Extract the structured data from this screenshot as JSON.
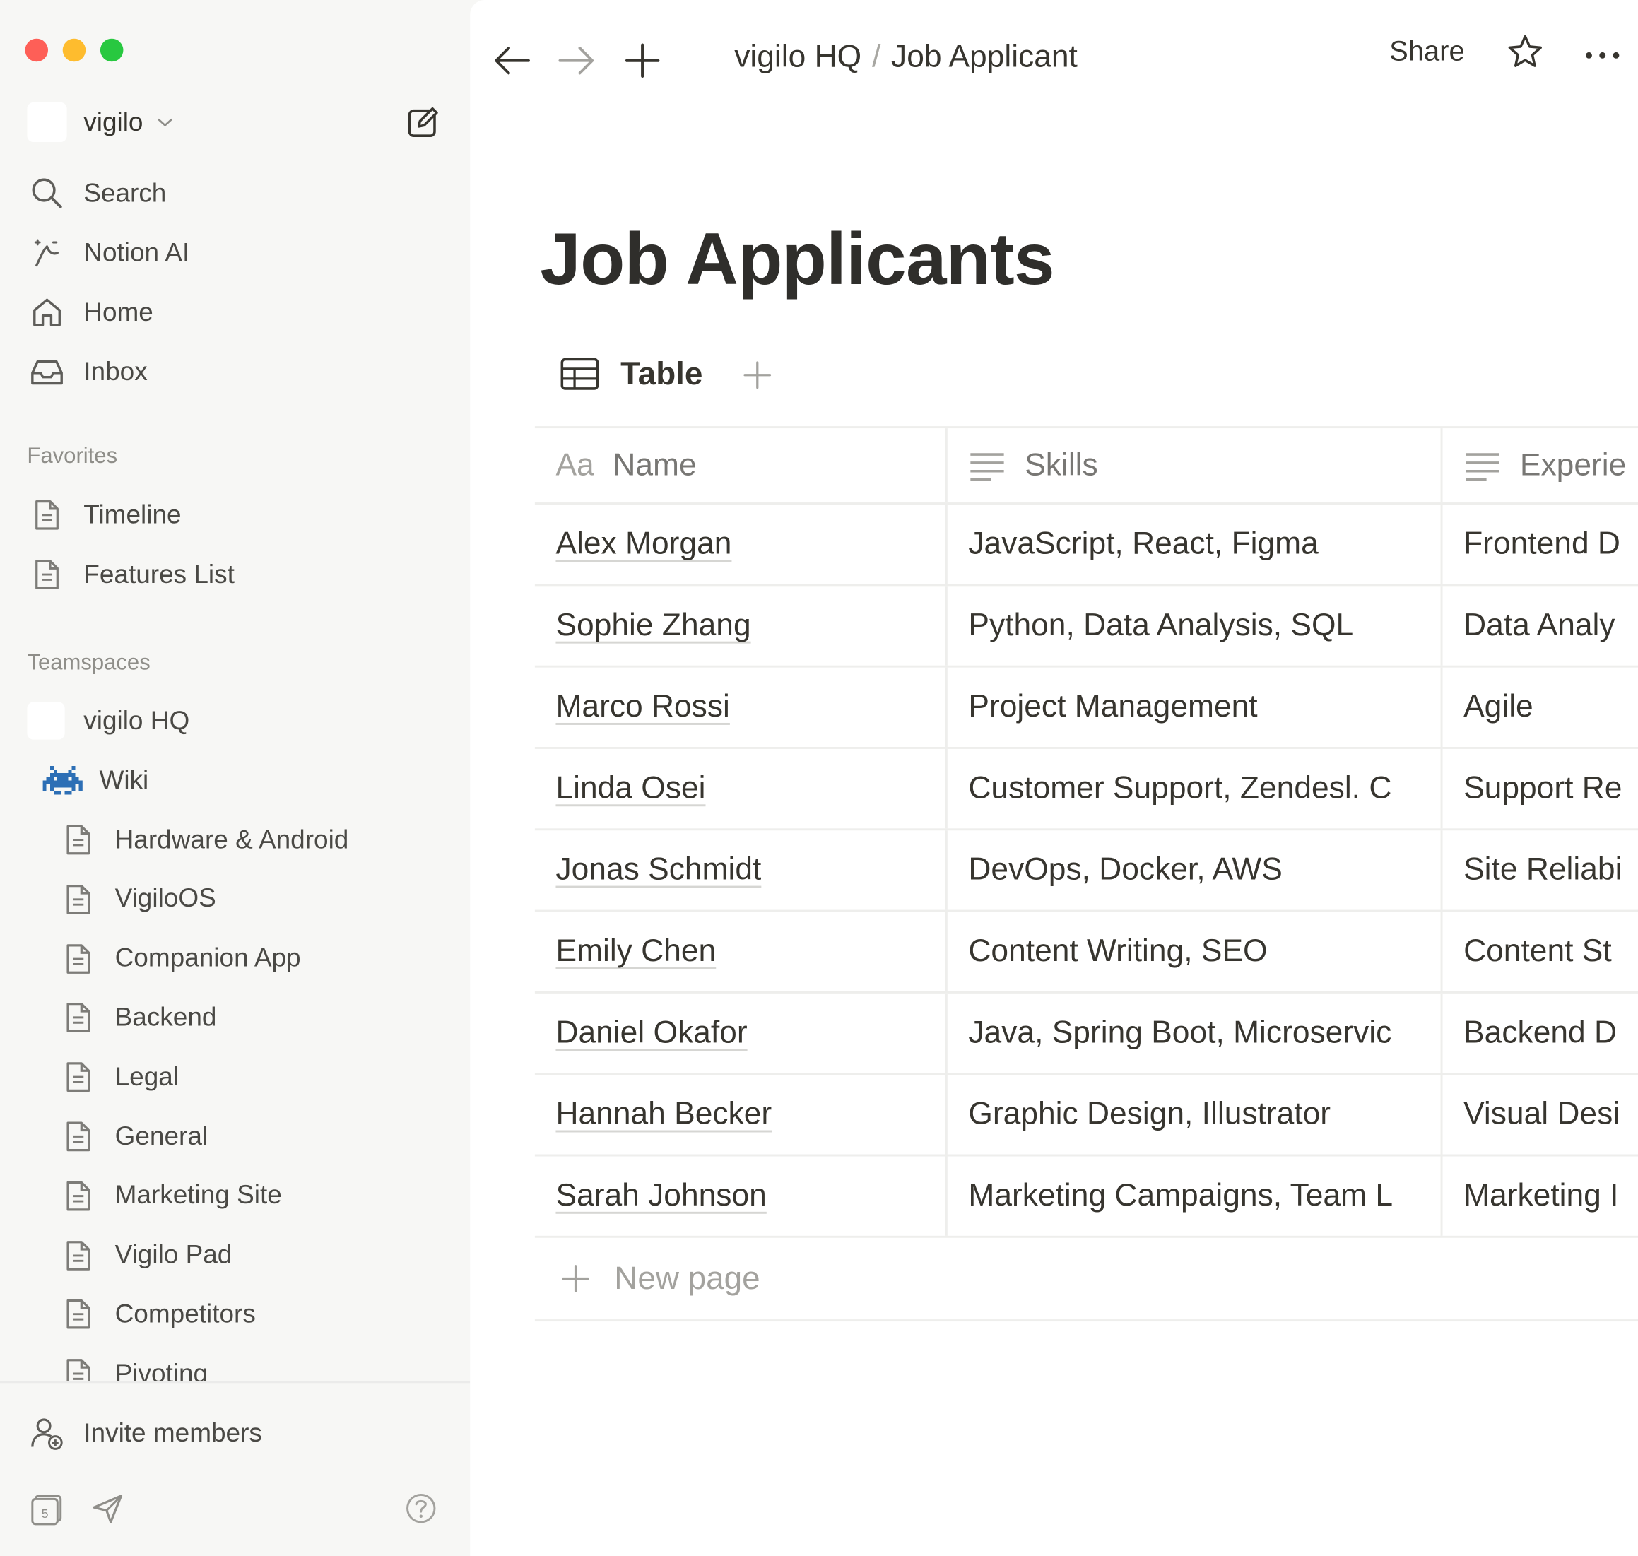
{
  "sidebar": {
    "workspace_name": "vigilo",
    "nav": [
      {
        "label": "Search",
        "icon": "search-icon"
      },
      {
        "label": "Notion AI",
        "icon": "notion-ai-icon"
      },
      {
        "label": "Home",
        "icon": "home-icon"
      },
      {
        "label": "Inbox",
        "icon": "inbox-icon"
      }
    ],
    "favorites_title": "Favorites",
    "favorites": [
      {
        "label": "Timeline",
        "icon": "page-icon"
      },
      {
        "label": "Features List",
        "icon": "page-icon"
      }
    ],
    "teamspaces_title": "Teamspaces",
    "teamspace": {
      "label": "vigilo HQ"
    },
    "wiki": {
      "label": "Wiki",
      "icon": "space-invader-icon"
    },
    "wiki_pages": [
      {
        "label": "Hardware & Android"
      },
      {
        "label": "VigiloOS"
      },
      {
        "label": "Companion App"
      },
      {
        "label": "Backend"
      },
      {
        "label": "Legal"
      },
      {
        "label": "General"
      },
      {
        "label": "Marketing Site"
      },
      {
        "label": "Vigilo Pad"
      },
      {
        "label": "Competitors"
      },
      {
        "label": "Pivoting"
      }
    ],
    "invite_label": "Invite members",
    "calendar_day": "5"
  },
  "topbar": {
    "breadcrumb_parent": "vigilo HQ",
    "breadcrumb_separator": "/",
    "breadcrumb_current": "Job Applicant",
    "share_label": "Share"
  },
  "page": {
    "title": "Job Applicants",
    "view_tab_label": "Table",
    "columns": [
      {
        "icon_text": "Aa",
        "label": "Name"
      },
      {
        "icon": "text-lines-icon",
        "label": "Skills"
      },
      {
        "icon": "text-lines-icon",
        "label": "Experie"
      }
    ],
    "rows": [
      {
        "name": "Alex Morgan",
        "skills": "JavaScript, React, Figma",
        "experience": "Frontend D"
      },
      {
        "name": "Sophie Zhang",
        "skills": "Python, Data Analysis, SQL",
        "experience": "Data Analy"
      },
      {
        "name": "Marco Rossi",
        "skills": "Project Management",
        "experience": "Agile"
      },
      {
        "name": "Linda Osei",
        "skills": "Customer Support, Zendesl. C",
        "experience": "Support Re"
      },
      {
        "name": "Jonas Schmidt",
        "skills": "DevOps, Docker, AWS",
        "experience": "Site Reliabi"
      },
      {
        "name": "Emily Chen",
        "skills": "Content Writing, SEO",
        "experience": "Content St"
      },
      {
        "name": "Daniel Okafor",
        "skills": "Java, Spring Boot, Microservic",
        "experience": "Backend D"
      },
      {
        "name": "Hannah Becker",
        "skills": "Graphic Design, Illustrator",
        "experience": "Visual Desi"
      },
      {
        "name": "Sarah Johnson",
        "skills": "Marketing Campaigns, Team L",
        "experience": "Marketing I"
      }
    ],
    "new_page_label": "New page"
  },
  "colors": {
    "sidebar_bg": "#f7f7f5",
    "main_bg": "#ffffff",
    "text": "#37352f",
    "muted": "#8f8e89",
    "traffic_red": "#fe5f57",
    "traffic_yellow": "#febc2e",
    "traffic_green": "#28c840",
    "wiki_icon": "#2d6fb5"
  }
}
